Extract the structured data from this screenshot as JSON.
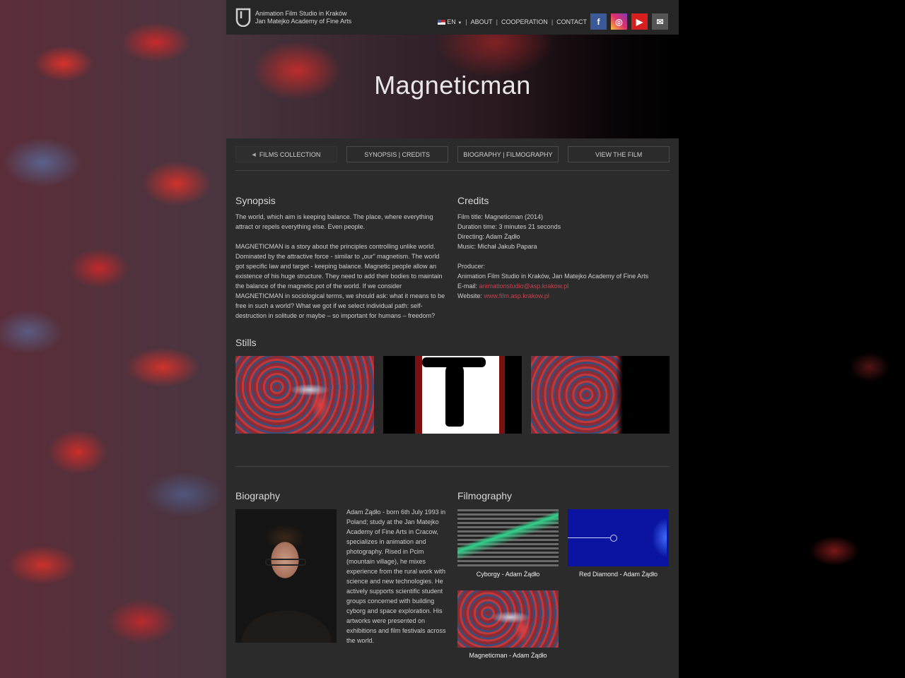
{
  "header": {
    "studio_line1": "Animation Film Studio in Kraków",
    "studio_line2": "Jan Matejko Academy of Fine Arts",
    "lang": "EN",
    "nav": [
      "ABOUT",
      "COOPERATION",
      "CONTACT"
    ],
    "social": [
      {
        "icon": "facebook-icon",
        "glyph": "f"
      },
      {
        "icon": "instagram-icon",
        "glyph": "◎"
      },
      {
        "icon": "youtube-icon",
        "glyph": "▶"
      },
      {
        "icon": "mail-icon",
        "glyph": "✉"
      }
    ]
  },
  "title": "Magneticman",
  "tabs": {
    "films": "FILMS COLLECTION",
    "synopsis": "SYNOPSIS | CREDITS",
    "bio": "BIOGRAPHY | FILMOGRAPHY",
    "view": "VIEW THE FILM"
  },
  "synopsis": {
    "heading": "Synopsis",
    "p1": "The world, which aim is keeping balance. The place, where everything attract or repels everything else. Even people.",
    "p2": "MAGNETICMAN is a story about the principles controlling unlike world. Dominated by the attractive force - similar to „our” magnetism. The world got specific law and target - keeping balance. Magnetic people allow an existence of his huge structure. They need to add their bodies to maintain the balance of the magnetic pot of the world. If we consider MAGNETICMAN in sociological terms, we should ask: what it means to be free in such a world? What we got if we select individual path: self-destruction in solitude or maybe – so important for humans – freedom?"
  },
  "credits": {
    "heading": "Credits",
    "film_title": "Film title: Magneticman (2014)",
    "duration": "Duration time: 3 minutes 21 seconds",
    "directing": "Directing: Adam Żądło",
    "music": "Music: Michał Jakub Papara",
    "producer_label": "Producer:",
    "producer": "Animation Film Studio in Kraków, Jan Matejko Academy of Fine Arts",
    "email_label": "E-mail:",
    "email": "animationstudio@asp.krakow.pl",
    "website_label": "Website:",
    "website": "www.film.asp.krakow.pl"
  },
  "stills_heading": "Stills",
  "biography": {
    "heading": "Biography",
    "text": "Adam Żądło - born 6th July 1993 in Poland; study at the Jan Matejko Academy of Fine Arts in Cracow, specializes in animation and photography. Rised in Pcim (mountain village), he mixes experience from the rural work with science and new technologies. He actively supports scientific student groups concerned with building cyborg and space exploration. His artworks were presented on exhibitions and film festivals across the world."
  },
  "filmography": {
    "heading": "Filmography",
    "films": [
      "Cyborgy - Adam Żądło",
      "Red Diamond - Adam Żądło",
      "Magneticman - Adam Żądło"
    ]
  }
}
